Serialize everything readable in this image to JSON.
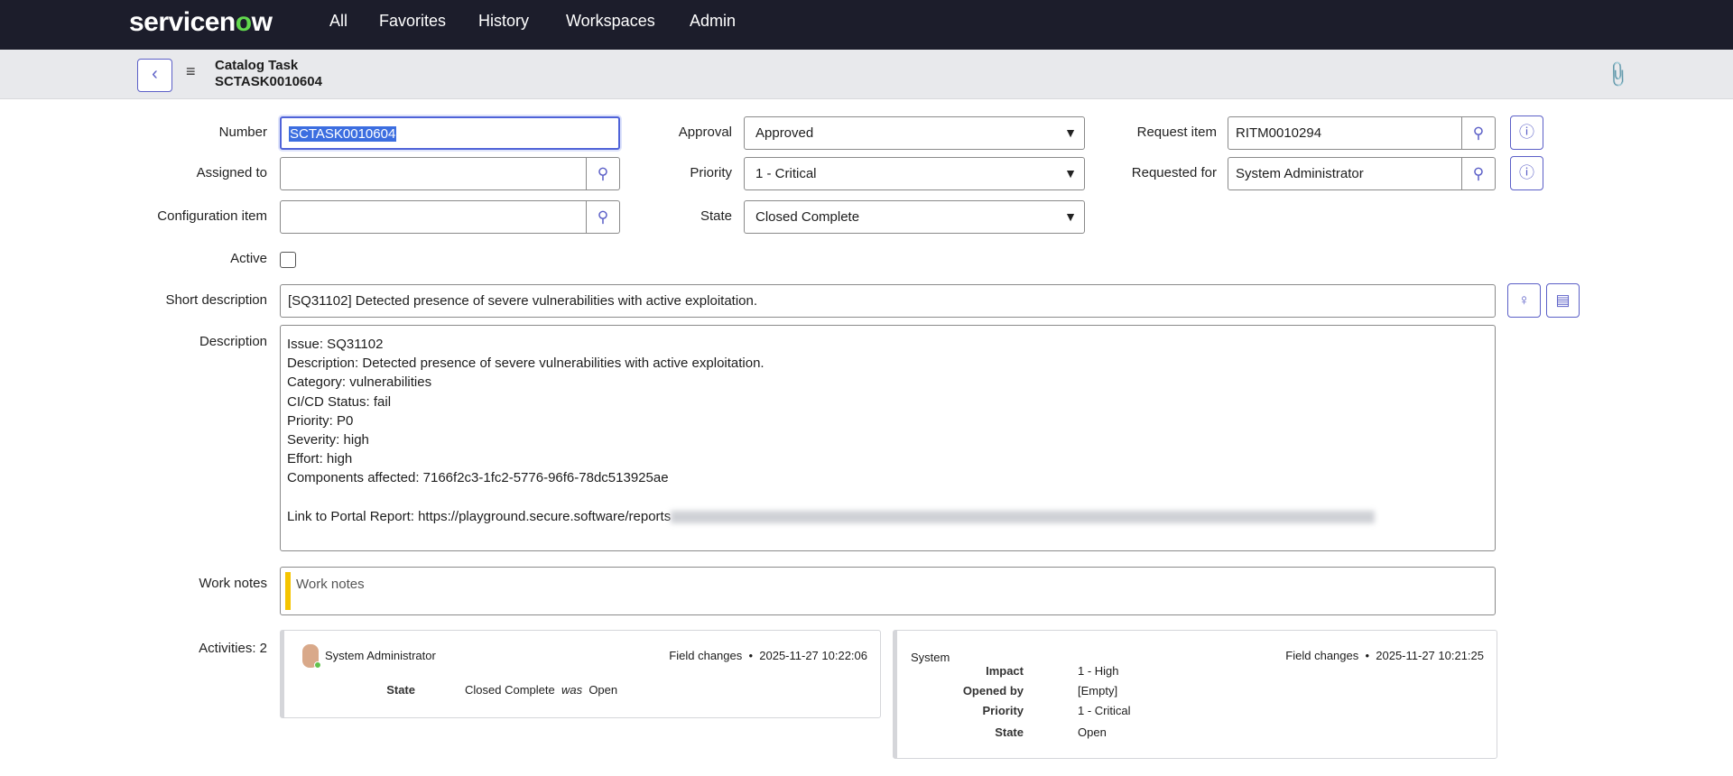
{
  "nav": {
    "logo": "servicenow",
    "items": [
      "All",
      "Favorites",
      "History",
      "Workspaces",
      "Admin"
    ]
  },
  "header": {
    "title": "Catalog Task",
    "number": "SCTASK0010604"
  },
  "form": {
    "number": {
      "label": "Number",
      "value": "SCTASK0010604"
    },
    "assigned_to": {
      "label": "Assigned to",
      "value": ""
    },
    "configuration_item": {
      "label": "Configuration item",
      "value": ""
    },
    "active": {
      "label": "Active",
      "checked": false
    },
    "approval": {
      "label": "Approval",
      "value": "Approved"
    },
    "priority": {
      "label": "Priority",
      "value": "1 - Critical"
    },
    "state": {
      "label": "State",
      "value": "Closed Complete"
    },
    "request_item": {
      "label": "Request item",
      "value": "RITM0010294"
    },
    "requested_for": {
      "label": "Requested for",
      "value": "System Administrator"
    },
    "short_description": {
      "label": "Short description",
      "value": "[SQ31102] Detected presence of severe vulnerabilities with active exploitation."
    },
    "description": {
      "label": "Description",
      "lines": [
        "Issue: SQ31102",
        "Description: Detected presence of severe vulnerabilities with active exploitation.",
        "Category: vulnerabilities",
        "CI/CD Status: fail",
        "Priority: P0",
        "Severity: high",
        "Effort: high",
        "Components affected: 7166f2c3-1fc2-5776-96f6-78dc513925ae",
        "",
        "Link to Portal Report: https://playground.secure.software/reports"
      ]
    },
    "work_notes": {
      "label": "Work notes",
      "placeholder": "Work notes"
    }
  },
  "activities": {
    "label": "Activities: 2",
    "entries": [
      {
        "who": "System Administrator",
        "type": "Field changes",
        "time": "2025-11-27 10:22:06",
        "changes": [
          {
            "field": "State",
            "new": "Closed Complete",
            "was_label": "was",
            "old": "Open"
          }
        ]
      },
      {
        "who": "System",
        "type": "Field changes",
        "time": "2025-11-27 10:21:25",
        "changes": [
          {
            "field": "Impact",
            "new": "1 - High"
          },
          {
            "field": "Opened by",
            "new": "[Empty]"
          },
          {
            "field": "Priority",
            "new": "1 - Critical"
          },
          {
            "field": "State",
            "new": "Open"
          }
        ]
      }
    ]
  },
  "colors": {
    "accent": "#5b5fc7",
    "nav_bg": "#1c1d2b",
    "work_notes_bar": "#f5c400"
  }
}
